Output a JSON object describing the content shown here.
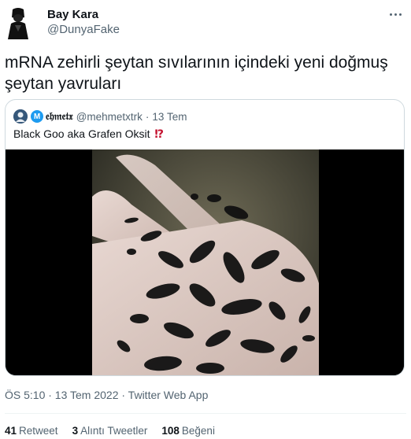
{
  "author": {
    "name": "Bay Kara",
    "handle": "@DunyaFake"
  },
  "tweet": {
    "text": "mRNA zehirli şeytan sıvılarının içindeki yeni doğmuş şeytan yavruları"
  },
  "quote": {
    "badge": "M",
    "name": "𝔢𝔥𝔪𝔢𝔱𝔵",
    "handle": "@mehmetxtrk",
    "separator": "·",
    "time": "13 Tem",
    "text": "Black Goo aka Grafen Oksit",
    "text_mark": "⁉"
  },
  "meta": {
    "text": "ÖS 5:10 · 13 Tem 2022 · Twitter Web App"
  },
  "stats": [
    {
      "count": "41",
      "label": "Retweet"
    },
    {
      "count": "3",
      "label": "Alıntı Tweetler"
    },
    {
      "count": "108",
      "label": "Beğeni"
    }
  ],
  "colors": {
    "text": "#0f1419",
    "secondary": "#536471",
    "border": "#cfd9de",
    "accent": "#1d9bf0",
    "mark": "#c4122f"
  },
  "icons": {
    "more": "more-horizontal-icon"
  }
}
